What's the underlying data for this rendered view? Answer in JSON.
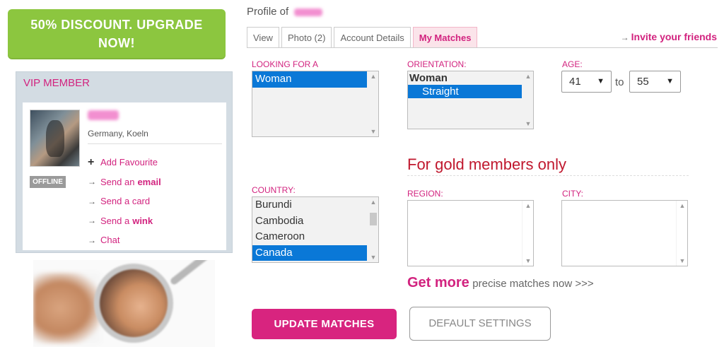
{
  "upgrade": {
    "line1": "50% DISCOUNT. UPGRADE",
    "line2": "NOW!"
  },
  "vip": {
    "title": "VIP MEMBER",
    "location": "Germany, Koeln",
    "status": "OFFLINE",
    "actions": {
      "add_favourite": "Add Favourite",
      "send_an": "Send an",
      "email": "email",
      "send_card": "Send a card",
      "send_a": "Send a",
      "wink": "wink",
      "chat": "Chat"
    }
  },
  "header": {
    "profile_of": "Profile of"
  },
  "tabs": [
    {
      "label": "View"
    },
    {
      "label": "Photo (2)"
    },
    {
      "label": "Account Details"
    },
    {
      "label": "My Matches"
    }
  ],
  "invite": "Invite your friends",
  "form": {
    "looking_for": {
      "label": "LOOKING FOR A",
      "options": [
        "Woman"
      ],
      "selected": "Woman"
    },
    "orientation": {
      "label": "ORIENTATION:",
      "group": "Woman",
      "options": [
        "Straight"
      ],
      "selected": "Straight"
    },
    "age": {
      "label": "AGE:",
      "from": "41",
      "to_label": "to",
      "to": "55"
    },
    "gold_notice": "For gold members only",
    "country": {
      "label": "COUNTRY:",
      "options": [
        "Burundi",
        "Cambodia",
        "Cameroon",
        "Canada"
      ],
      "selected": "Canada"
    },
    "region": {
      "label": "REGION:"
    },
    "city": {
      "label": "CITY:"
    }
  },
  "get_more": {
    "big": "Get more",
    "small": "precise matches now >>>"
  },
  "buttons": {
    "update": "UPDATE MATCHES",
    "default": "DEFAULT SETTINGS"
  },
  "colors": {
    "accent": "#d2237f",
    "upgrade_green": "#8cc63f",
    "selection_blue": "#0a78d7",
    "gold_red": "#c0182e"
  }
}
